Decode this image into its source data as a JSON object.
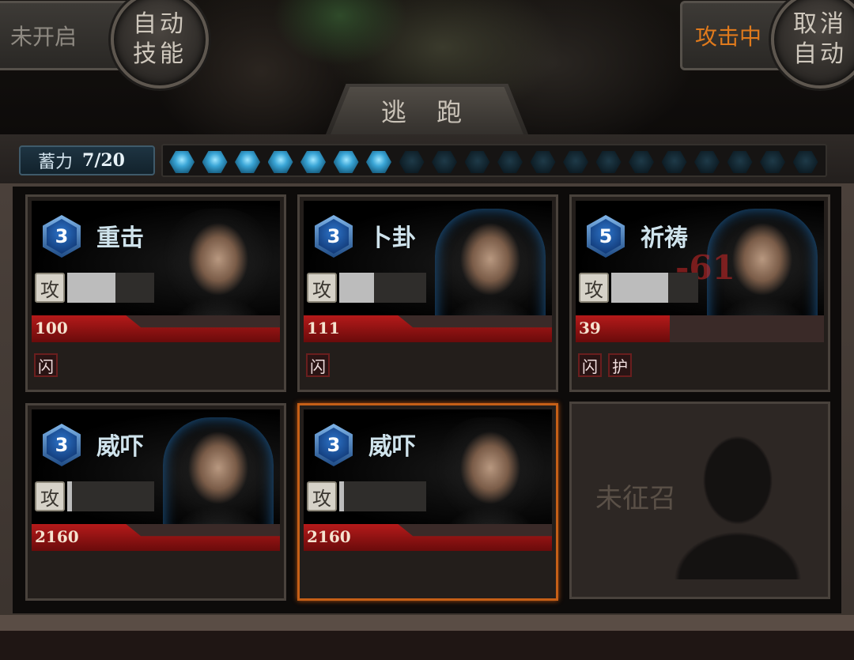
{
  "auto_skill": {
    "status": "未开启",
    "button": "自动技能"
  },
  "auto_attack": {
    "status": "攻击中",
    "button": "取消自动"
  },
  "flee_label": "逃 跑",
  "charge": {
    "label": "蓄力",
    "count": "7/20",
    "filled": 7,
    "total": 20
  },
  "cards": [
    {
      "level": "3",
      "skill": "重击",
      "atk_label": "攻",
      "atk_fill": 0.55,
      "hp": "100",
      "hp_fraction": 1.0,
      "statuses": [
        "闪"
      ]
    },
    {
      "level": "3",
      "skill": "卜卦",
      "atk_label": "攻",
      "atk_fill": 0.4,
      "hp": "111",
      "hp_fraction": 1.0,
      "statuses": [
        "闪"
      ]
    },
    {
      "level": "5",
      "skill": "祈祷",
      "atk_label": "攻",
      "atk_fill": 0.65,
      "hp": "39",
      "hp_fraction": 0.38,
      "statuses": [
        "闪",
        "护"
      ],
      "damage": "-61"
    },
    {
      "level": "3",
      "skill": "威吓",
      "atk_label": "攻",
      "atk_fill": 0.05,
      "hp": "2160",
      "hp_fraction": 1.0,
      "statuses": []
    },
    {
      "level": "3",
      "skill": "威吓",
      "atk_label": "攻",
      "atk_fill": 0.05,
      "hp": "2160",
      "hp_fraction": 1.0,
      "statuses": [],
      "selected": true
    }
  ],
  "empty_slot": {
    "label": "未征召"
  },
  "colors": {
    "accent_orange": "#e07a1c",
    "hp_red": "#b51a1a",
    "charge_blue": "#3aa5d6"
  }
}
